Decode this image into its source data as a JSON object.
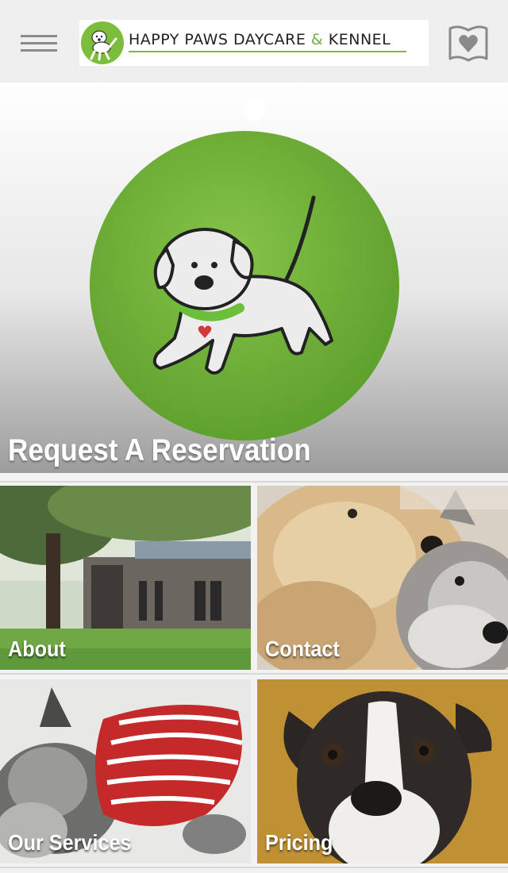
{
  "header": {
    "brand_name_part1": "HAPPY PAWS DAYCARE ",
    "brand_amp": "&",
    "brand_name_part2": " KENNEL",
    "menu_icon": "hamburger-menu-icon",
    "favorites_icon": "book-heart-icon"
  },
  "hero": {
    "title": "Request A Reservation",
    "logo": "happy-paws-dog-logo"
  },
  "tiles": [
    {
      "label": "About",
      "image": "kennel-building-photo"
    },
    {
      "label": "Contact",
      "image": "two-dogs-photo"
    },
    {
      "label": "Our Services",
      "image": "schnauzer-in-sweater-photo"
    },
    {
      "label": "Pricing",
      "image": "boston-terrier-photo"
    }
  ],
  "colors": {
    "brand_green": "#7dbd3c",
    "header_bg": "#efefef",
    "label_text": "#ffffff"
  }
}
